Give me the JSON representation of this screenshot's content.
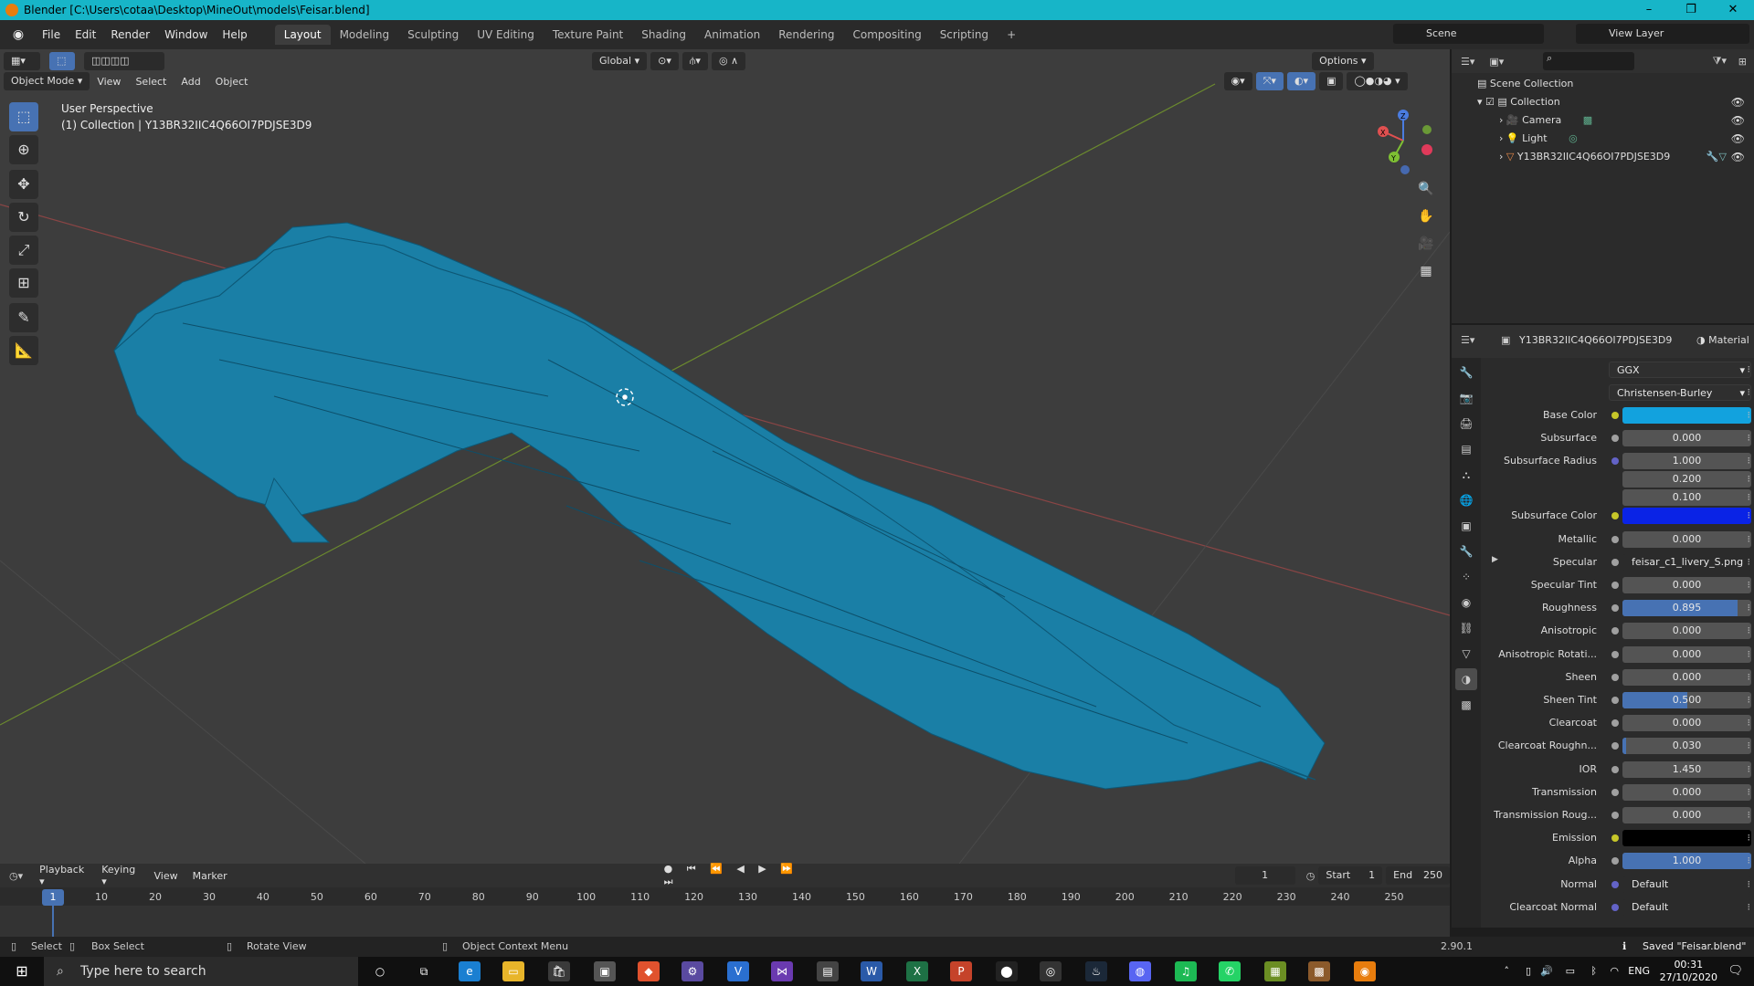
{
  "window": {
    "title": "Blender [C:\\Users\\cotaa\\Desktop\\MineOut\\models\\Feisar.blend]",
    "minimize": "–",
    "maximize": "❐",
    "close": "✕"
  },
  "menubar": {
    "menus": [
      "File",
      "Edit",
      "Render",
      "Window",
      "Help"
    ],
    "workspaces": [
      "Layout",
      "Modeling",
      "Sculpting",
      "UV Editing",
      "Texture Paint",
      "Shading",
      "Animation",
      "Rendering",
      "Compositing",
      "Scripting"
    ],
    "active_workspace": "Layout",
    "add_tab": "+",
    "scene": "Scene",
    "view_layer": "View Layer"
  },
  "viewport": {
    "mode": "Object Mode",
    "menus": [
      "View",
      "Select",
      "Add",
      "Object"
    ],
    "orientation": "Global",
    "options": "Options",
    "perspective": "User Perspective",
    "collection_info": "(1) Collection | Y13BR32IIC4Q66OI7PDJSE3D9",
    "model_color": "#1a7fa6",
    "gizmo": {
      "x": "X",
      "y": "Y",
      "z": "Z"
    }
  },
  "toolbar_icons": [
    "select-box-icon",
    "cursor-icon",
    "move-icon",
    "rotate-icon",
    "scale-icon",
    "transform-icon",
    "annotate-icon",
    "measure-icon"
  ],
  "outliner": {
    "root": "Scene Collection",
    "items": [
      {
        "name": "Collection"
      },
      {
        "name": "Camera"
      },
      {
        "name": "Light"
      },
      {
        "name": "Y13BR32IIC4Q66OI7PDJSE3D9"
      }
    ]
  },
  "properties": {
    "object_name": "Y13BR32IIC4Q66OI7PDJSE3D9",
    "tab_label": "Material",
    "distribution": "GGX",
    "subsurface_method": "Christensen-Burley",
    "rows": [
      {
        "label": "Base Color",
        "type": "color",
        "color": "#12a2de",
        "dot": "yellow"
      },
      {
        "label": "Subsurface",
        "type": "number",
        "value": "0.000",
        "fill": 0,
        "dot": "grey"
      },
      {
        "label": "Subsurface Radius",
        "type": "number",
        "value": "1.000",
        "fill": 0,
        "dot": "purple"
      },
      {
        "label": "",
        "type": "number",
        "value": "0.200",
        "fill": 0,
        "dot": "none"
      },
      {
        "label": "",
        "type": "number",
        "value": "0.100",
        "fill": 0,
        "dot": "none"
      },
      {
        "label": "Subsurface Color",
        "type": "color",
        "color": "#0a23e6",
        "dot": "yellow"
      },
      {
        "label": "Metallic",
        "type": "number",
        "value": "0.000",
        "fill": 0,
        "dot": "grey"
      },
      {
        "label": "Specular",
        "type": "text",
        "value": "feisar_c1_livery_S.png",
        "dot": "grey"
      },
      {
        "label": "Specular Tint",
        "type": "number",
        "value": "0.000",
        "fill": 0,
        "dot": "grey"
      },
      {
        "label": "Roughness",
        "type": "number",
        "value": "0.895",
        "fill": 0.895,
        "dot": "grey"
      },
      {
        "label": "Anisotropic",
        "type": "number",
        "value": "0.000",
        "fill": 0,
        "dot": "grey"
      },
      {
        "label": "Anisotropic Rotati...",
        "type": "number",
        "value": "0.000",
        "fill": 0,
        "dot": "grey"
      },
      {
        "label": "Sheen",
        "type": "number",
        "value": "0.000",
        "fill": 0,
        "dot": "grey"
      },
      {
        "label": "Sheen Tint",
        "type": "number",
        "value": "0.500",
        "fill": 0.5,
        "dot": "grey"
      },
      {
        "label": "Clearcoat",
        "type": "number",
        "value": "0.000",
        "fill": 0,
        "dot": "grey"
      },
      {
        "label": "Clearcoat Roughn...",
        "type": "number",
        "value": "0.030",
        "fill": 0.03,
        "dot": "grey"
      },
      {
        "label": "IOR",
        "type": "number",
        "value": "1.450",
        "fill": 0,
        "dot": "grey"
      },
      {
        "label": "Transmission",
        "type": "number",
        "value": "0.000",
        "fill": 0,
        "dot": "grey"
      },
      {
        "label": "Transmission Roug...",
        "type": "number",
        "value": "0.000",
        "fill": 0,
        "dot": "grey"
      },
      {
        "label": "Emission",
        "type": "color",
        "color": "#000000",
        "dot": "yellow"
      },
      {
        "label": "Alpha",
        "type": "number",
        "value": "1.000",
        "fill": 1.0,
        "dot": "grey"
      },
      {
        "label": "Normal",
        "type": "text",
        "value": "Default",
        "dot": "purple"
      },
      {
        "label": "Clearcoat Normal",
        "type": "text",
        "value": "Default",
        "dot": "purple"
      }
    ]
  },
  "timeline": {
    "menus": [
      "Playback",
      "Keying",
      "View",
      "Marker"
    ],
    "current_frame": "1",
    "start_label": "Start",
    "start": "1",
    "end_label": "End",
    "end": "250",
    "ticks": [
      "1",
      "10",
      "20",
      "30",
      "40",
      "50",
      "60",
      "70",
      "80",
      "90",
      "100",
      "110",
      "120",
      "130",
      "140",
      "150",
      "160",
      "170",
      "180",
      "190",
      "200",
      "210",
      "220",
      "230",
      "240",
      "250"
    ]
  },
  "statusbar": {
    "select": "Select",
    "box_select": "Box Select",
    "rotate_view": "Rotate View",
    "context_menu": "Object Context Menu",
    "version": "2.90.1",
    "saved": "Saved \"Feisar.blend\""
  },
  "taskbar": {
    "search_placeholder": "Type here to search",
    "language": "ENG",
    "time": "00:31",
    "date": "27/10/2020"
  }
}
